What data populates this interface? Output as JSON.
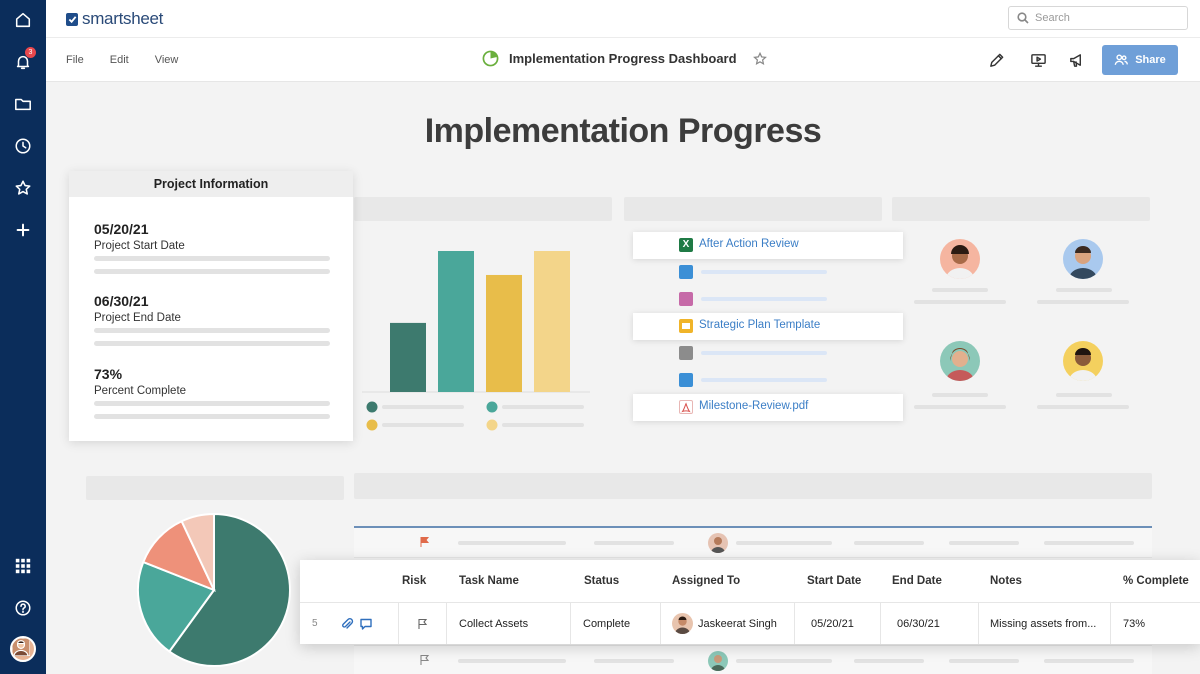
{
  "app": {
    "brand": "smartsheet"
  },
  "notifications": {
    "count": "3"
  },
  "search": {
    "placeholder": "Search"
  },
  "menu": {
    "file": "File",
    "edit": "Edit",
    "view": "View"
  },
  "document": {
    "title": "Implementation Progress Dashboard"
  },
  "toolbar": {
    "share_label": "Share",
    "accent": "#6f9fd8"
  },
  "dashboard": {
    "heading": "Implementation Progress",
    "project_info": {
      "title": "Project Information",
      "items": [
        {
          "value": "05/20/21",
          "label": "Project Start Date"
        },
        {
          "value": "06/30/21",
          "label": "Project End Date"
        },
        {
          "value": "73%",
          "label": "Percent Complete"
        }
      ]
    },
    "files": [
      {
        "name": "After Action Review",
        "icon": "excel-icon",
        "color": "#1f7a45"
      },
      {
        "name": "Strategic Plan Template",
        "icon": "slides-icon",
        "color": "#f0b429"
      },
      {
        "name": "Milestone-Review.pdf",
        "icon": "pdf-icon",
        "color": "#d9534f"
      }
    ]
  },
  "chart_data": [
    {
      "type": "bar",
      "categories": [
        "",
        "",
        "",
        ""
      ],
      "values": [
        49,
        100,
        83,
        100
      ],
      "colors": [
        "#3d7a6e",
        "#4aa79a",
        "#e8bd4a",
        "#f3d58a"
      ],
      "grid": false
    },
    {
      "type": "pie",
      "values": [
        60,
        21,
        12,
        7
      ],
      "colors": [
        "#3d7a6e",
        "#4aa79a",
        "#ee917a",
        "#f3c8b8"
      ]
    }
  ],
  "task_table": {
    "columns": [
      "Risk",
      "Task Name",
      "Status",
      "Assigned To",
      "Start Date",
      "End Date",
      "Notes",
      "% Complete"
    ],
    "row": {
      "number": "5",
      "task": "Collect Assets",
      "status": "Complete",
      "assigned_to": "Jaskeerat Singh",
      "start": "05/20/21",
      "end": "06/30/21",
      "notes": "Missing assets from...",
      "percent": "73%"
    }
  }
}
